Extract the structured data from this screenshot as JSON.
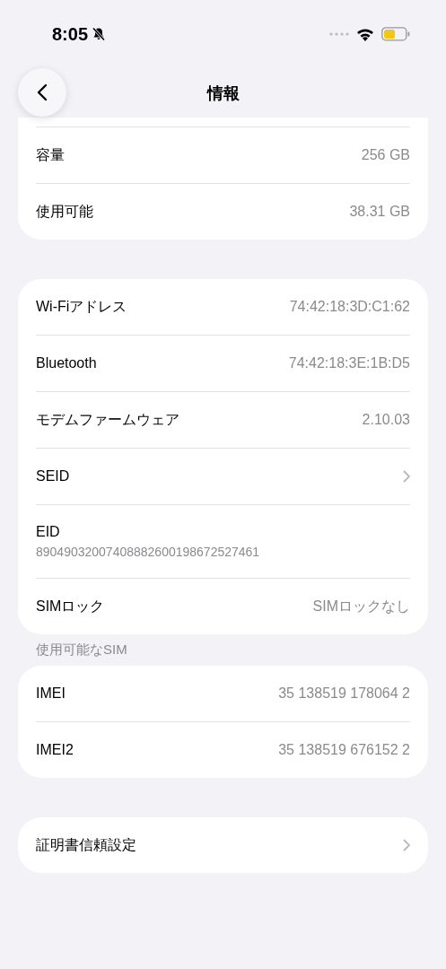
{
  "status_bar": {
    "time": "8:05"
  },
  "nav": {
    "title": "情報"
  },
  "groups": [
    {
      "cut_top": true,
      "rows": [
        {
          "kind": "value",
          "label": "容量",
          "value": "256 GB"
        },
        {
          "kind": "value",
          "label": "使用可能",
          "value": "38.31 GB"
        }
      ]
    },
    {
      "rows": [
        {
          "kind": "value",
          "label": "Wi-Fiアドレス",
          "value": "74:42:18:3D:C1:62"
        },
        {
          "kind": "value",
          "label": "Bluetooth",
          "value": "74:42:18:3E:1B:D5"
        },
        {
          "kind": "value",
          "label": "モデムファームウェア",
          "value": "2.10.03"
        },
        {
          "kind": "chevron",
          "label": "SEID"
        },
        {
          "kind": "stacked",
          "label": "EID",
          "value": "89049032007408882600198672527461"
        },
        {
          "kind": "value",
          "label": "SIMロック",
          "value": "SIMロックなし"
        }
      ]
    },
    {
      "header": "使用可能なSIM",
      "rows": [
        {
          "kind": "value",
          "label": "IMEI",
          "value": "35 138519 178064 2"
        },
        {
          "kind": "value",
          "label": "IMEI2",
          "value": "35 138519 676152 2"
        }
      ]
    },
    {
      "rows": [
        {
          "kind": "chevron",
          "label": "証明書信頼設定"
        }
      ]
    }
  ]
}
